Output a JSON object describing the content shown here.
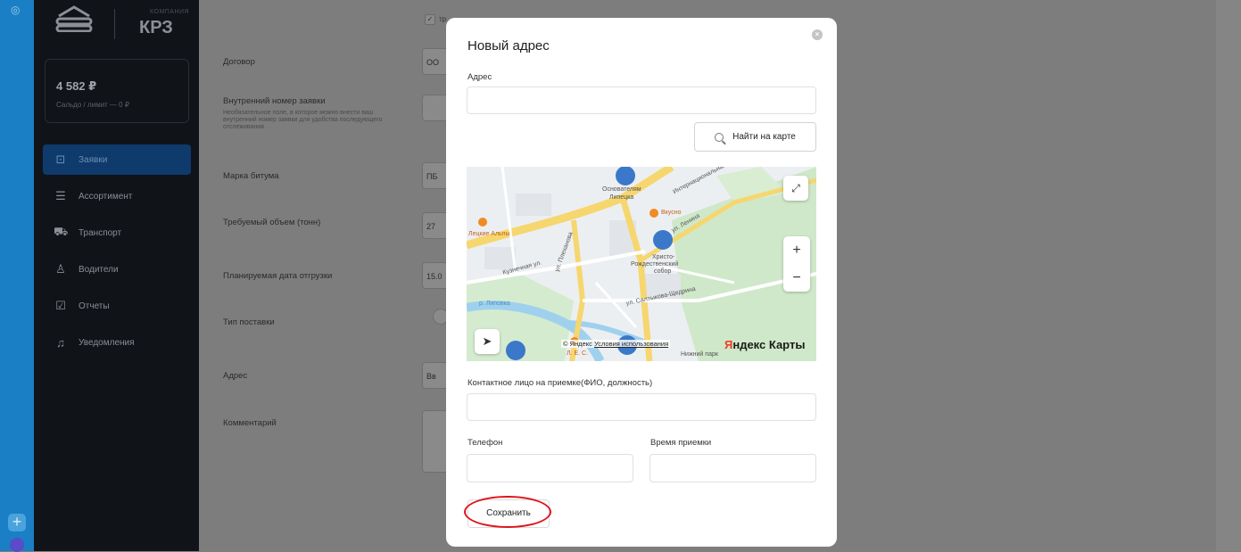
{
  "brand": {
    "company_label": "КОМПАНИЯ",
    "name": "КРЗ"
  },
  "balance": {
    "amount": "4 582 ₽",
    "subtitle": "Сальдо / лимит — 0 ₽"
  },
  "sidebar": {
    "items": [
      {
        "label": "Заявки",
        "icon": "requests-icon",
        "active": true
      },
      {
        "label": "Ассортимент",
        "icon": "assortment-icon",
        "active": false
      },
      {
        "label": "Транспорт",
        "icon": "truck-icon",
        "active": false
      },
      {
        "label": "Водители",
        "icon": "drivers-icon",
        "active": false
      },
      {
        "label": "Отчеты",
        "icon": "reports-icon",
        "active": false
      },
      {
        "label": "Уведомления",
        "icon": "bell-icon",
        "active": false
      }
    ]
  },
  "form": {
    "checkbox_label": "тр",
    "contract_label": "Договор",
    "contract_value": "ОО",
    "internal_number_label": "Внутренний номер заявки",
    "internal_number_hint": "Необязательное поле, в которое можно внести ваш внутренний номер заявки для удобства последующего отслеживания",
    "bitumen_label": "Марка битума",
    "bitumen_value": "ПБ",
    "volume_label": "Требуемый объем (тонн)",
    "volume_value": "27",
    "date_label": "Планируемая дата отгрузки",
    "date_value": "15.0",
    "delivery_type_label": "Тип поставки",
    "address_label": "Адрес",
    "address_placeholder": "Вв",
    "comment_label": "Комментарий"
  },
  "modal": {
    "title": "Новый адрес",
    "address_label": "Адрес",
    "address_value": "",
    "find_on_map_label": "Найти на карте",
    "contact_label": "Контактное лицо на приемке(ФИО, должность)",
    "contact_value": "",
    "phone_label": "Телефон",
    "phone_value": "",
    "time_label": "Время приемки",
    "time_value": "",
    "save_label": "Сохранить"
  },
  "map": {
    "labels": {
      "founders": "Основателям",
      "lipetsk": "Липецка",
      "vkusno": "Вкусно",
      "alps": "Лецкие Альпы",
      "kuznechnaya": "Кузнечная ул.",
      "pesochnaya": "ул. Плеханова",
      "khristo1": "Христо-",
      "khristo2": "Рождественский",
      "khristo3": "собор",
      "lenina": "ул. Ленина",
      "lipovka": "р. Липовка",
      "saltykova": "ул. Салтыкова-Щедрина",
      "internatsionalnaya": "Интернациональная",
      "les": "Л. Е. С.",
      "park": "Нижний парк"
    },
    "attribution_prefix": "© Яндекс",
    "terms_link": "Условия использования",
    "yandex_y": "Я",
    "yandex_rest": "ндекс Карты",
    "zoom_in": "+",
    "zoom_out": "−"
  }
}
